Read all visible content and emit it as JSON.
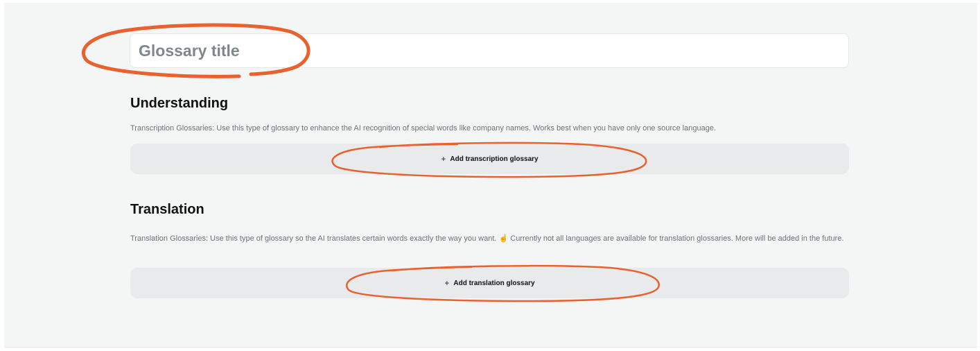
{
  "title_field": {
    "value": "",
    "placeholder": "Glossary title"
  },
  "understanding": {
    "heading": "Understanding",
    "description": "Transcription Glossaries: Use this type of glossary to enhance the AI recognition of special words like company names. Works best when you have only one source language.",
    "button_icon": "+",
    "button_label": "Add transcription glossary"
  },
  "translation": {
    "heading": "Translation",
    "description": "Translation Glossaries: Use this type of glossary so the AI translates certain words exactly the way you want. ☝️ Currently not all languages are available for translation glossaries. More will be added in the future.",
    "button_icon": "+",
    "button_label": "Add translation glossary"
  },
  "colors": {
    "background": "#f4f5f5",
    "button_background": "#e8eaeb",
    "annotation_stroke": "#e9612f"
  }
}
